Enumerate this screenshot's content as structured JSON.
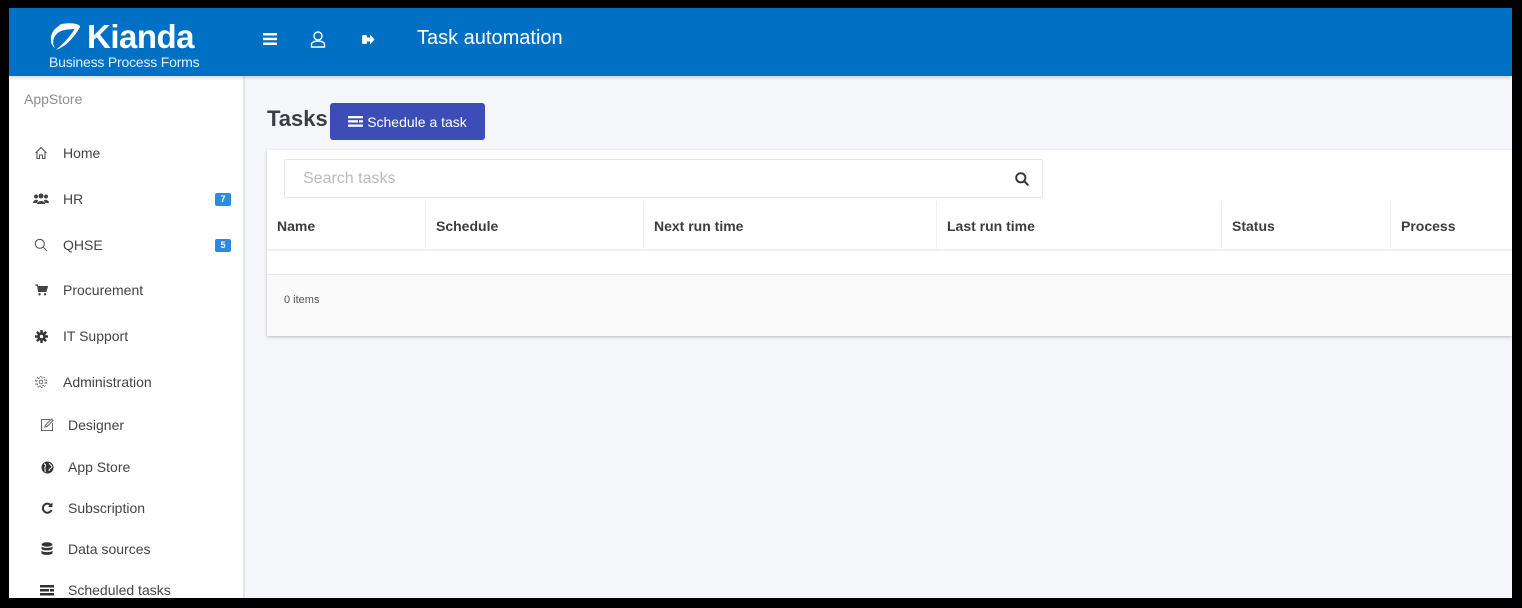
{
  "header": {
    "logo_name": "Kianda",
    "logo_tagline": "Business Process Forms",
    "icons": [
      "menu-icon",
      "user-icon",
      "sign-out-icon"
    ],
    "title": "Task automation",
    "brand_color": "#0070c4"
  },
  "sidebar": {
    "section_title": "AppStore",
    "items": [
      {
        "label": "Home",
        "icon": "home-icon"
      },
      {
        "label": "HR",
        "icon": "users-icon",
        "badge": "7"
      },
      {
        "label": "QHSE",
        "icon": "search-icon",
        "badge": "5"
      },
      {
        "label": "Procurement",
        "icon": "cart-icon"
      },
      {
        "label": "IT Support",
        "icon": "cog-icon"
      },
      {
        "label": "Administration",
        "icon": "settings-icon"
      }
    ],
    "admin_items": [
      {
        "label": "Designer",
        "icon": "edit-icon"
      },
      {
        "label": "App Store",
        "icon": "globe-icon"
      },
      {
        "label": "Subscription",
        "icon": "refresh-icon"
      },
      {
        "label": "Data sources",
        "icon": "database-icon"
      },
      {
        "label": "Scheduled tasks",
        "icon": "tasks-icon"
      }
    ],
    "badge_color": "#2b8be0"
  },
  "main": {
    "page_title": "Tasks",
    "schedule_button": "Schedule a task",
    "button_color": "#3d4db8",
    "search": {
      "placeholder": "Search tasks",
      "value": ""
    },
    "table": {
      "columns": [
        "Name",
        "Schedule",
        "Next run time",
        "Last run time",
        "Status",
        "Process"
      ],
      "rows": []
    },
    "items_count": "0 items"
  }
}
